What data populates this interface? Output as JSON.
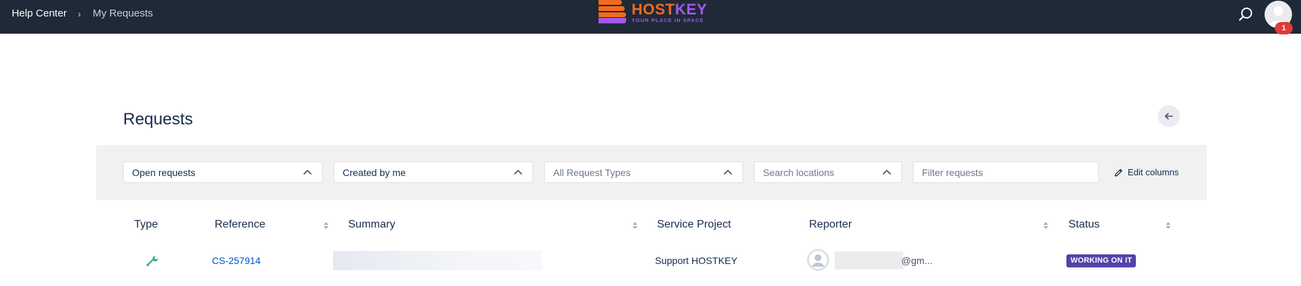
{
  "breadcrumb": {
    "home": "Help Center",
    "separator": "›",
    "current": "My Requests"
  },
  "logo": {
    "brand_part1": "HOST",
    "brand_part2": "KEY",
    "tagline": "YOUR PLACE IN SPACE",
    "colors": {
      "orange": "#f26b1d",
      "purple": "#a259e6"
    }
  },
  "header_icons": {
    "search": "search-icon",
    "avatar": "user-avatar-icon"
  },
  "notifications": {
    "count": "1"
  },
  "page": {
    "title": "Requests",
    "back_icon": "arrow-left-icon"
  },
  "filters": {
    "status": "Open requests",
    "created_by": "Created by me",
    "request_types_placeholder": "All Request Types",
    "locations_placeholder": "Search locations",
    "search_placeholder": "Filter requests",
    "edit_columns_label": "Edit columns"
  },
  "table": {
    "columns": [
      "Type",
      "Reference",
      "Summary",
      "Service Project",
      "Reporter",
      "Status"
    ],
    "rows": [
      {
        "type_icon": "wrench-icon",
        "reference": "CS-257914",
        "summary": "",
        "service_project": "Support HOSTKEY",
        "reporter_email_suffix": "@gm...",
        "status": "WORKING ON IT"
      }
    ]
  },
  "colors": {
    "topbar": "#1f2937",
    "link": "#0052cc",
    "status_lozenge": "#5243aa",
    "badge": "#e03a3a",
    "type_icon": "#36b37e"
  }
}
